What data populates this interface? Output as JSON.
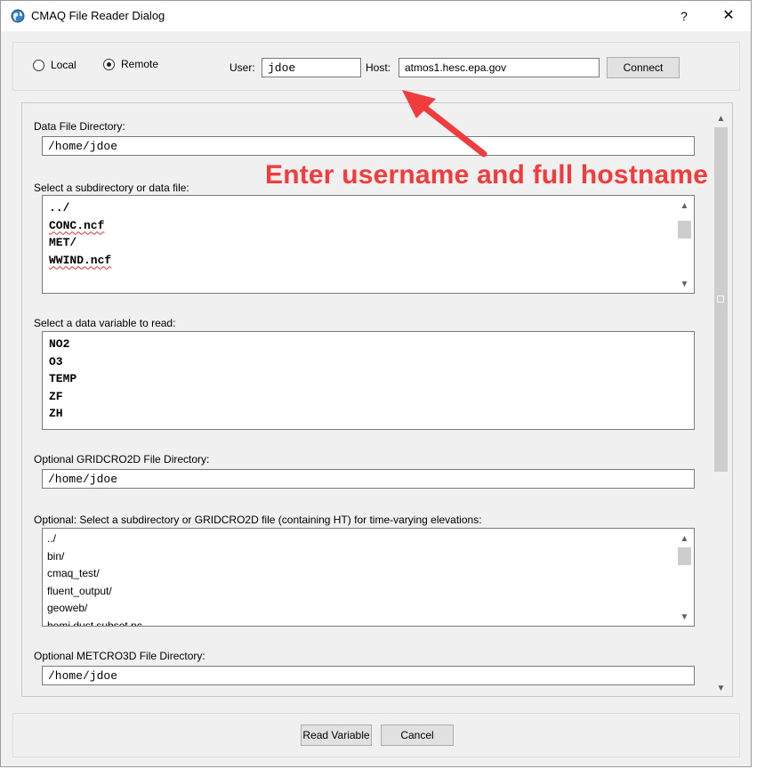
{
  "window": {
    "title": "CMAQ File Reader Dialog",
    "help_glyph": "?",
    "close_glyph": "✕"
  },
  "connection": {
    "local_label": "Local",
    "remote_label": "Remote",
    "selected_mode": "Remote",
    "user_label": "User:",
    "user_value": "jdoe",
    "host_label": "Host:",
    "host_value": "atmos1.hesc.epa.gov",
    "connect_label": "Connect"
  },
  "data_dir": {
    "label": "Data File Directory:",
    "value": "/home/jdoe"
  },
  "subdir_list": {
    "label": "Select a subdirectory or data file:",
    "items": [
      "../",
      "CONC.ncf",
      "MET/",
      "WWIND.ncf"
    ]
  },
  "variable_list": {
    "label": "Select a data variable to read:",
    "items": [
      "NO2",
      "O3",
      "TEMP",
      "ZF",
      "ZH"
    ]
  },
  "gridcro_dir": {
    "label": "Optional GRIDCRO2D File Directory:",
    "value": "/home/jdoe"
  },
  "gridcro_list": {
    "label": "Optional: Select a subdirectory or GRIDCRO2D file (containing HT) for time-varying elevations:",
    "items": [
      "../",
      "bin/",
      "cmaq_test/",
      "fluent_output/",
      "geoweb/",
      "hemi dust subset.nc"
    ]
  },
  "metcro_dir": {
    "label": "Optional METCRO3D File Directory:",
    "value": "/home/jdoe"
  },
  "footer": {
    "read_label": "Read Variable",
    "cancel_label": "Cancel"
  },
  "annotation": {
    "text": "Enter username and full hostname",
    "color": "#f03c3c"
  },
  "scroll_glyphs": {
    "up": "▲",
    "down": "▼"
  }
}
